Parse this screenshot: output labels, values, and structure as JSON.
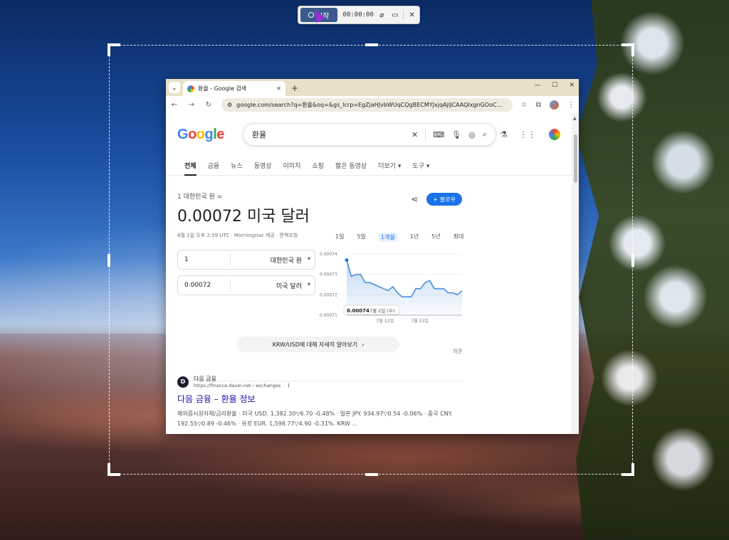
{
  "capture_toolbar": {
    "start_label": "시작",
    "timer": "00:00:00"
  },
  "browser": {
    "tab_title": "환율 - Google 검색",
    "url": "google.com/search?q=환율&oq=&gs_lcrp=EgZjaHJvbWUqCQgBECMYJxjqAjIJCAAQIxgnGOoC...",
    "search_query": "환율",
    "logo": {
      "letters": [
        "G",
        "o",
        "o",
        "g",
        "l",
        "e"
      ]
    },
    "filters": [
      "전체",
      "금융",
      "뉴스",
      "동영상",
      "이미지",
      "쇼핑",
      "짧은 동영상",
      "더보기 ▾",
      "도구 ▾"
    ],
    "fx": {
      "from_label": "1 대한민국 원 =",
      "value": "0.00072 미국 달러",
      "meta": "8월 1일 오후 2:59 UTC · Morningstar 제공 · 면책조항",
      "follow_label": "팔로우",
      "amount_from": "1",
      "currency_from": "대한민국 원",
      "amount_to": "0.00072",
      "currency_to": "미국 달러",
      "ranges": [
        "1일",
        "5일",
        "1개월",
        "1년",
        "5년",
        "최대"
      ],
      "selected_range": "1개월",
      "more_label": "KRW/USD에 대해 자세히 알아보기",
      "feedback": "의견"
    },
    "result": {
      "site_icon_letter": "D",
      "site_name": "다음 금융",
      "site_url": "https://finance.daum.net › exchanges",
      "title": "다음 금융 – 환율 정보",
      "snippet": "해외증시원자재/금리환율 · 미국 USD. 1,382.30▽6.70 -0.48% · 일본 JPY. 934.97▽0.54 -0.06% · 중국 CNY. 192.55▽0.89 -0.46% · 유로 EUR. 1,598.77▽4.90 -0.31%. KRW ..."
    }
  },
  "chart_data": {
    "type": "area",
    "y_ticks": [
      "0.00074",
      "0.00073",
      "0.00072",
      "0.00071"
    ],
    "ylim": [
      0.00071,
      0.00074
    ],
    "x_ticks": [
      "7월 12일",
      "7월 23일"
    ],
    "tooltip_value": "0.00074",
    "tooltip_date": "7월 2일 (수)",
    "values": [
      0.000737,
      0.000729,
      0.00073,
      0.00073,
      0.000726,
      0.000726,
      0.000725,
      0.000724,
      0.000723,
      0.000722,
      0.000724,
      0.000721,
      0.000719,
      0.000719,
      0.000719,
      0.000723,
      0.000723,
      0.000726,
      0.000727,
      0.000723,
      0.000723,
      0.000723,
      0.000721,
      0.000721,
      0.00072,
      0.000722
    ],
    "line_color": "#4a90d9"
  }
}
